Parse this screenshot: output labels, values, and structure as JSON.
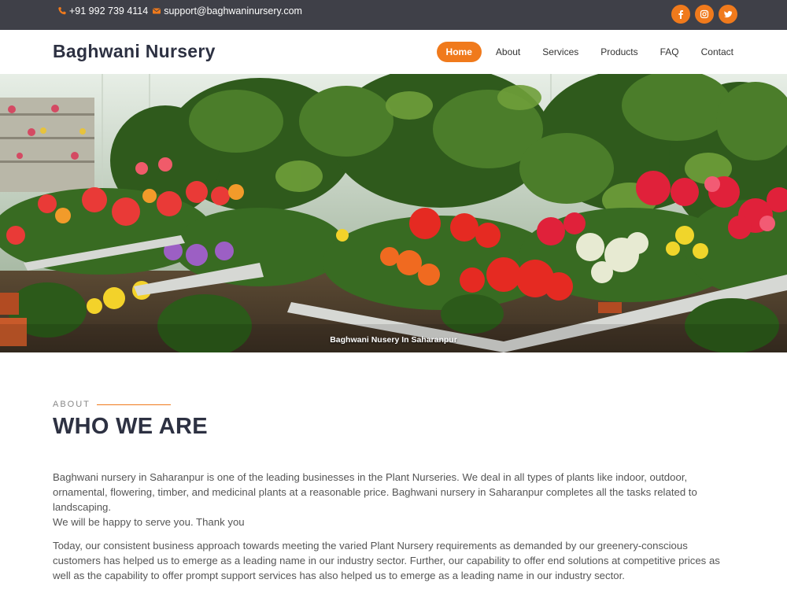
{
  "topbar": {
    "phone": "+91 992 739 4114",
    "email": "support@baghwaninursery.com",
    "social": [
      {
        "name": "facebook",
        "icon": "facebook-icon"
      },
      {
        "name": "instagram",
        "icon": "instagram-icon"
      },
      {
        "name": "twitter",
        "icon": "twitter-icon"
      }
    ]
  },
  "header": {
    "logo": "Baghwani Nursery",
    "nav": [
      "Home",
      "About",
      "Services",
      "Products",
      "FAQ",
      "Contact"
    ],
    "active": "Home"
  },
  "hero": {
    "caption": "Baghwani Nusery In Saharanpur"
  },
  "about": {
    "eyebrow": "ABOUT",
    "title": "WHO WE ARE",
    "p1a": "Baghwani nursery in Saharanpur is one of the leading businesses in the Plant Nurseries. We deal in all types of plants like indoor, outdoor, ornamental, flowering, timber, and medicinal plants at a reasonable price. Baghwani nursery in Saharanpur completes all the tasks related to landscaping.",
    "p1b": "We will be happy to serve you. Thank you",
    "p2": "Today, our consistent business approach towards meeting the varied Plant Nursery requirements as demanded by our greenery-conscious customers has helped us to emerge as a leading name in our industry sector. Further, our capability to offer end solutions at competitive prices as well as the capability to offer prompt support services has also helped us to emerge as a leading name in our industry sector."
  },
  "colors": {
    "accent": "#f07a1c",
    "topbar": "#3f4048",
    "heading": "#2d3142"
  }
}
